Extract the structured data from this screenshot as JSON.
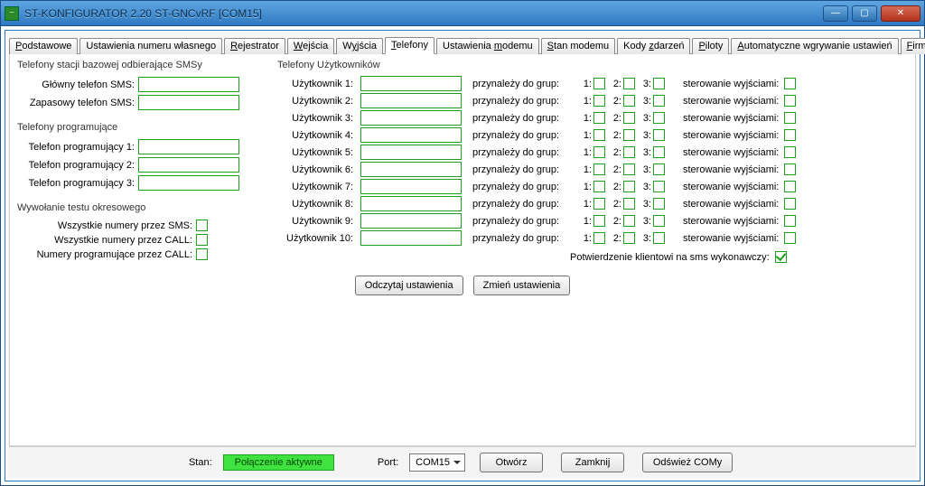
{
  "window": {
    "title": "ST-KONFIGURATOR 2.20 ST-GNCvRF   [COM15]"
  },
  "tabs": [
    "Podstawowe",
    "Ustawienia numeru własnego",
    "Rejestrator",
    "Wejścia",
    "Wyjścia",
    "Telefony",
    "Ustawienia modemu",
    "Stan modemu",
    "Kody zdarzeń",
    "Piloty",
    "Automatyczne wgrywanie ustawień",
    "Firmware"
  ],
  "active_tab_index": 5,
  "left": {
    "sms_group": {
      "legend": "Telefony stacji bazowej odbierające SMSy",
      "rows": [
        {
          "label": "Główny telefon SMS:",
          "value": ""
        },
        {
          "label": "Zapasowy telefon SMS:",
          "value": ""
        }
      ]
    },
    "prog_group": {
      "legend": "Telefony programujące",
      "rows": [
        {
          "label": "Telefon programujący 1:",
          "value": ""
        },
        {
          "label": "Telefon programujący 2:",
          "value": ""
        },
        {
          "label": "Telefon programujący 3:",
          "value": ""
        }
      ]
    },
    "test_group": {
      "legend": "Wywołanie testu okresowego",
      "rows": [
        {
          "label": "Wszystkie numery przez SMS:",
          "checked": false
        },
        {
          "label": "Wszystkie numery przez CALL:",
          "checked": false
        },
        {
          "label": "Numery programujące przez CALL:",
          "checked": false
        }
      ]
    }
  },
  "right": {
    "legend": "Telefony Użytkowników",
    "belongs_label": "przynależy do grup:",
    "group_numbers": [
      "1:",
      "2:",
      "3:"
    ],
    "control_label": "sterowanie wyjściami:",
    "users": [
      {
        "label": "Użytkownik 1:",
        "value": ""
      },
      {
        "label": "Użytkownik 2:",
        "value": ""
      },
      {
        "label": "Użytkownik 3:",
        "value": ""
      },
      {
        "label": "Użytkownik 4:",
        "value": ""
      },
      {
        "label": "Użytkownik 5:",
        "value": ""
      },
      {
        "label": "Użytkownik 6:",
        "value": ""
      },
      {
        "label": "Użytkownik 7:",
        "value": ""
      },
      {
        "label": "Użytkownik 8:",
        "value": ""
      },
      {
        "label": "Użytkownik 9:",
        "value": ""
      },
      {
        "label": "Użytkownik 10:",
        "value": ""
      }
    ],
    "confirm": {
      "label": "Potwierdzenie klientowi na sms wykonawczy:",
      "checked": true
    }
  },
  "buttons": {
    "read": "Odczytaj ustawienia",
    "write": "Zmień ustawienia"
  },
  "status": {
    "stan_label": "Stan:",
    "stan_value": "Połączenie aktywne",
    "port_label": "Port:",
    "port_value": "COM15",
    "open": "Otwórz",
    "close": "Zamknij",
    "refresh": "Odśwież COMy"
  }
}
